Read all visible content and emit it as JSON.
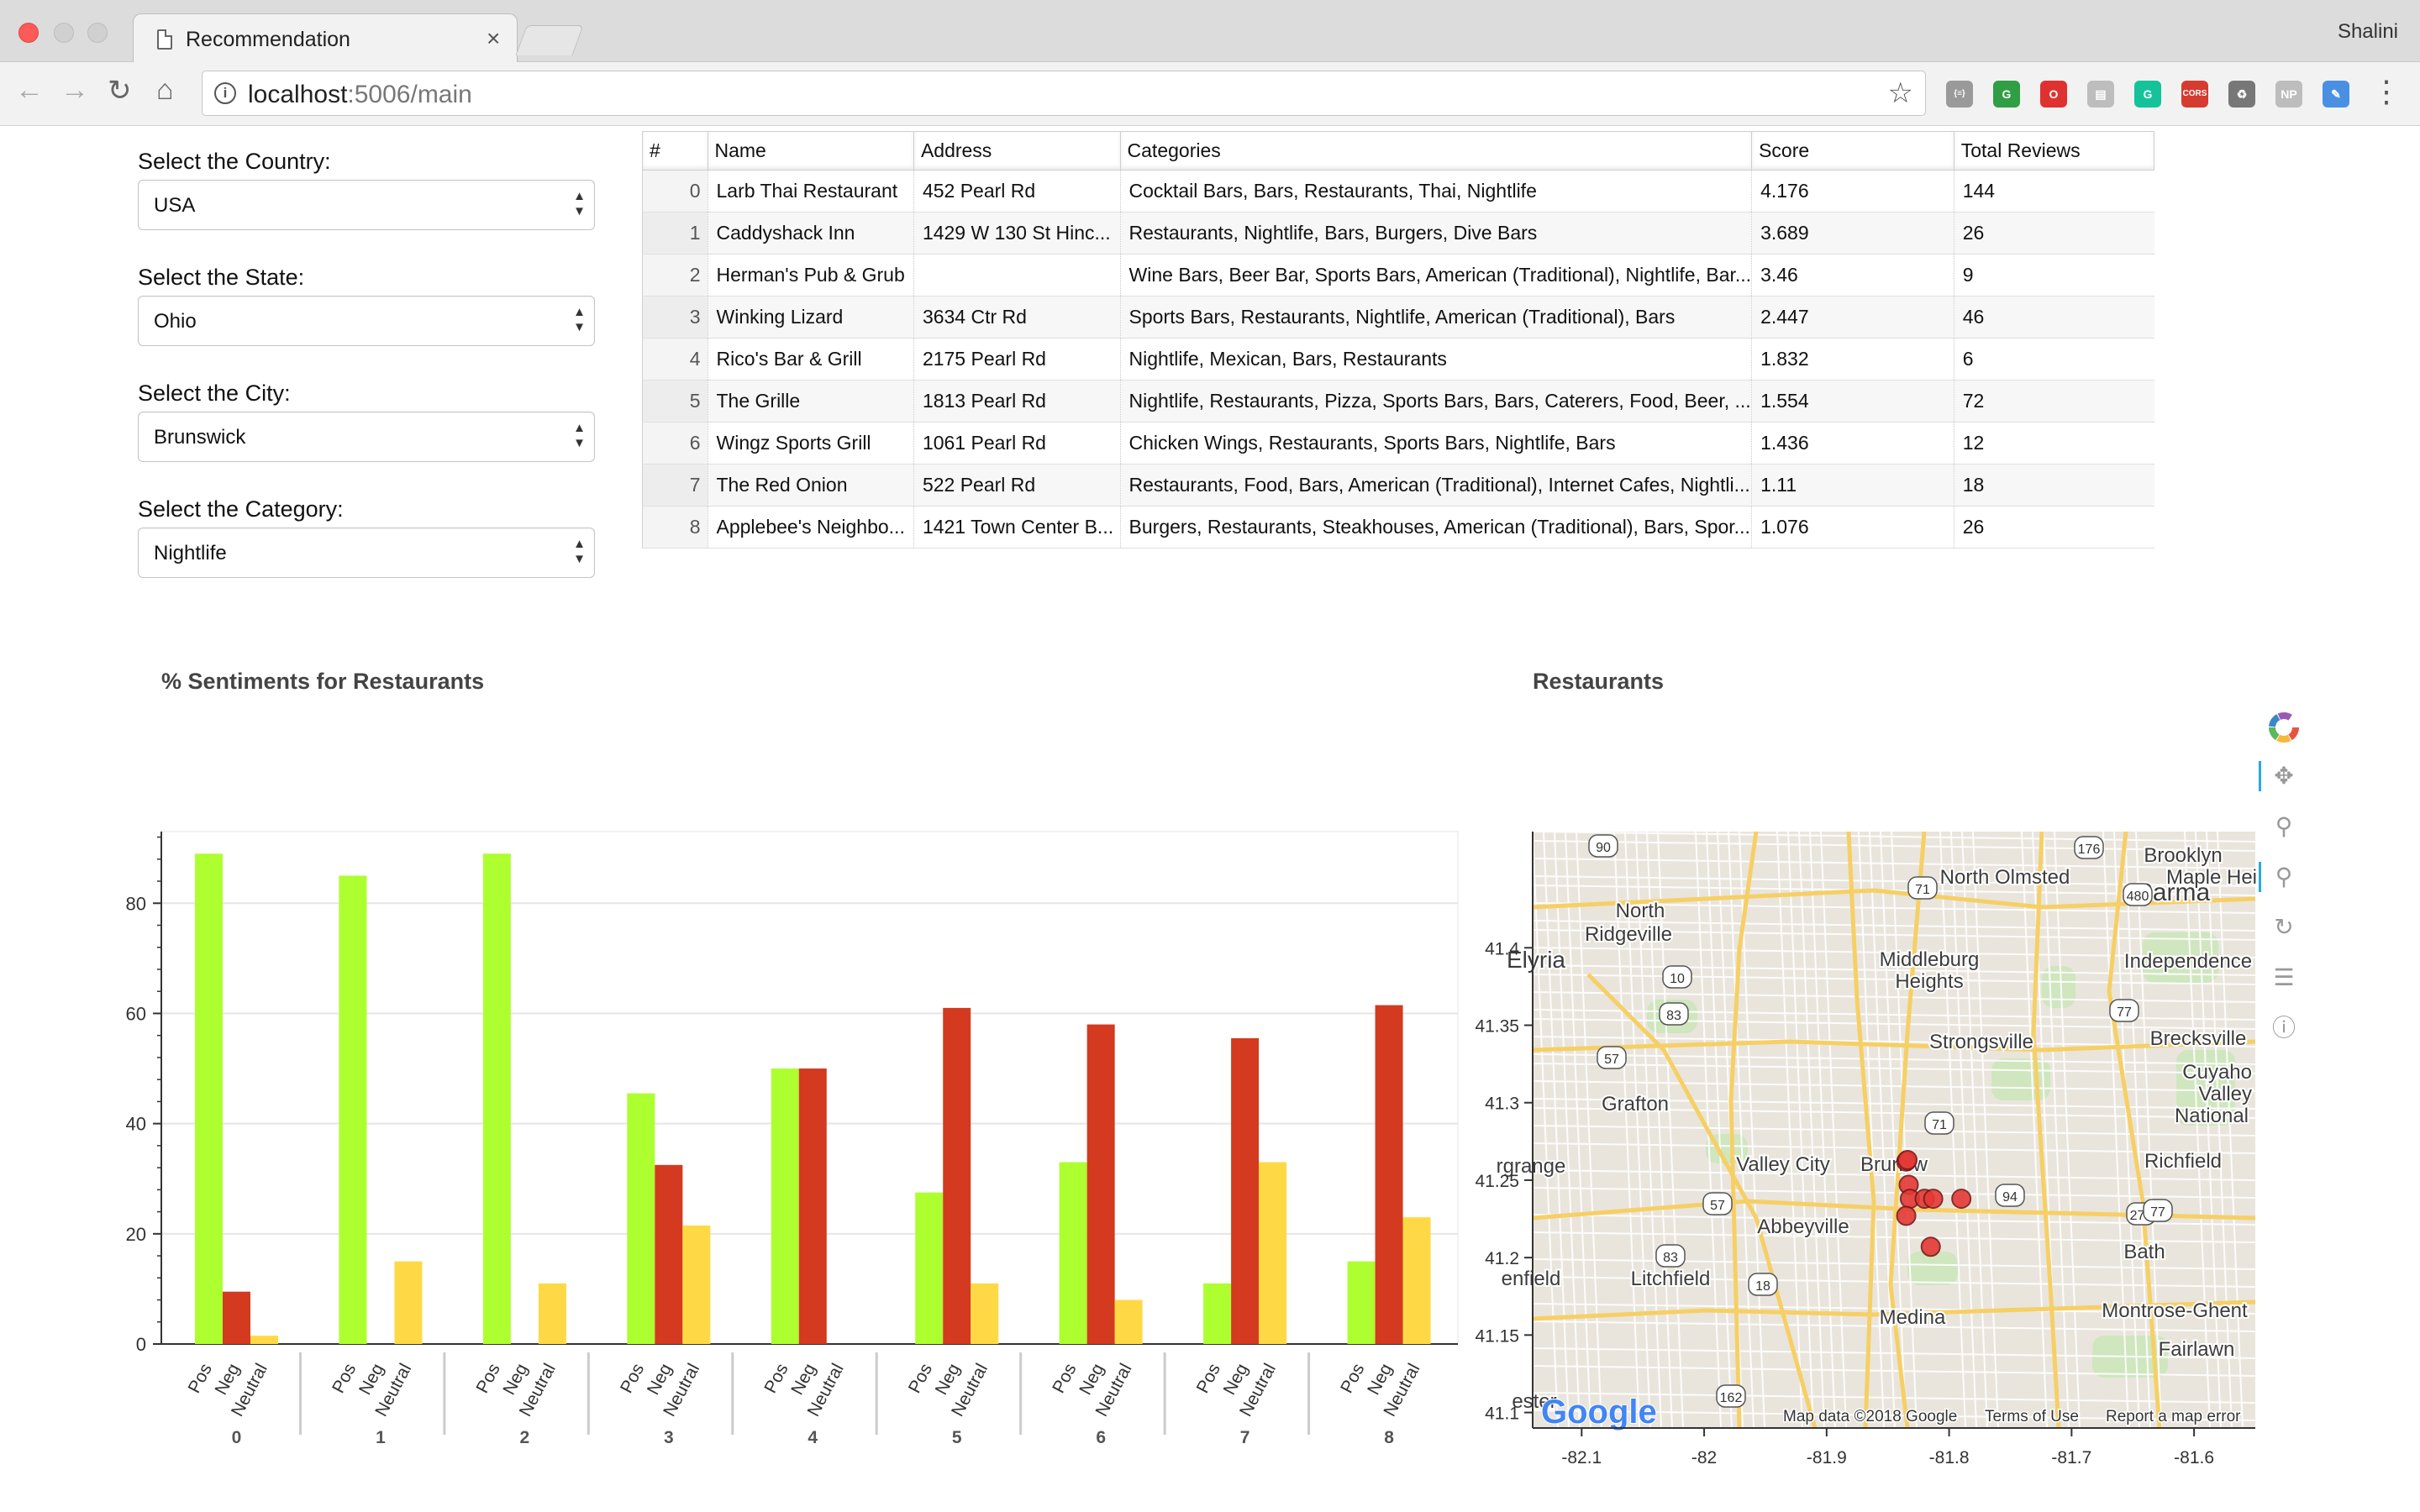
{
  "browser": {
    "tab_title": "Recommendation",
    "tab_close": "×",
    "profile_name": "Shalini",
    "url_host": "localhost",
    "url_rest": ":5006/main",
    "extensions": [
      {
        "name": "json-viewer-icon",
        "label": "{≡}",
        "color": "#9a9a9a"
      },
      {
        "name": "ghostery-icon",
        "label": "G",
        "color": "#2f9e44"
      },
      {
        "name": "opera-icon",
        "label": "O",
        "color": "#e03131"
      },
      {
        "name": "reader-icon",
        "label": "▤",
        "color": "#bdbdbd"
      },
      {
        "name": "grammarly-icon",
        "label": "G",
        "color": "#15c39a"
      },
      {
        "name": "cors-icon",
        "label": "CORS",
        "color": "#d63b2f"
      },
      {
        "name": "recycle-icon",
        "label": "♻",
        "color": "#777777"
      },
      {
        "name": "np-icon",
        "label": "NP",
        "color": "#bdbdbd"
      },
      {
        "name": "pen-icon",
        "label": "✎",
        "color": "#4a90e2"
      }
    ]
  },
  "filters": [
    {
      "label": "Select the Country:",
      "value": "USA"
    },
    {
      "label": "Select the State:",
      "value": "Ohio"
    },
    {
      "label": "Select the City:",
      "value": "Brunswick"
    },
    {
      "label": "Select the Category:",
      "value": "Nightlife"
    }
  ],
  "table": {
    "columns": [
      "#",
      "Name",
      "Address",
      "Categories",
      "Score",
      "Total Reviews"
    ],
    "rows": [
      [
        "0",
        "Larb Thai Restaurant",
        "452 Pearl Rd",
        "Cocktail Bars, Bars, Restaurants, Thai, Nightlife",
        "4.176",
        "144"
      ],
      [
        "1",
        "Caddyshack Inn",
        "1429 W 130 St Hinc...",
        "Restaurants, Nightlife, Bars, Burgers, Dive Bars",
        "3.689",
        "26"
      ],
      [
        "2",
        "Herman's Pub & Grub",
        "",
        "Wine Bars, Beer Bar, Sports Bars, American (Traditional), Nightlife, Bar...",
        "3.46",
        "9"
      ],
      [
        "3",
        "Winking Lizard",
        "3634 Ctr Rd",
        "Sports Bars, Restaurants, Nightlife, American (Traditional), Bars",
        "2.447",
        "46"
      ],
      [
        "4",
        "Rico's Bar & Grill",
        "2175 Pearl Rd",
        "Nightlife, Mexican, Bars, Restaurants",
        "1.832",
        "6"
      ],
      [
        "5",
        "The Grille",
        "1813 Pearl Rd",
        "Nightlife, Restaurants, Pizza, Sports Bars, Bars, Caterers, Food, Beer, ...",
        "1.554",
        "72"
      ],
      [
        "6",
        "Wingz Sports Grill",
        "1061 Pearl Rd",
        "Chicken Wings, Restaurants, Sports Bars, Nightlife, Bars",
        "1.436",
        "12"
      ],
      [
        "7",
        "The Red Onion",
        "522 Pearl Rd",
        "Restaurants, Food, Bars, American (Traditional), Internet Cafes, Nightli...",
        "1.11",
        "18"
      ],
      [
        "8",
        "Applebee's Neighbo...",
        "1421 Town Center B...",
        "Burgers, Restaurants, Steakhouses, American (Traditional), Bars, Spor...",
        "1.076",
        "26"
      ]
    ]
  },
  "chart_data": [
    {
      "type": "bar",
      "title": "% Sentiments for Restaurants",
      "categories": [
        "0",
        "1",
        "2",
        "3",
        "4",
        "5",
        "6",
        "7",
        "8"
      ],
      "subcategories": [
        "Pos",
        "Neg",
        "Neutral"
      ],
      "series": [
        {
          "name": "Pos",
          "color": "#adff2f",
          "values": [
            89,
            85,
            89,
            45.5,
            50,
            27.5,
            33,
            11,
            15
          ]
        },
        {
          "name": "Neg",
          "color": "#d33a1f",
          "values": [
            9.5,
            0,
            0,
            32.5,
            50,
            61,
            58,
            55.5,
            61.5
          ]
        },
        {
          "name": "Neutral",
          "color": "#ffd945",
          "values": [
            1.5,
            15,
            11,
            21.5,
            0,
            11,
            8,
            33,
            23
          ]
        }
      ],
      "yticks": [
        "0",
        "20",
        "40",
        "60",
        "80"
      ],
      "ylim": [
        0,
        93
      ],
      "grid": true
    },
    {
      "type": "scatter",
      "title": "Restaurants",
      "x": [
        -81.835,
        -81.833,
        -81.832,
        -81.835,
        -81.82,
        -81.813,
        -81.79,
        -81.815,
        -81.834
      ],
      "y": [
        41.262,
        41.247,
        41.238,
        41.227,
        41.238,
        41.238,
        41.238,
        41.207,
        41.263
      ],
      "xticks": [
        "-82.1",
        "-82",
        "-81.9",
        "-81.8",
        "-81.7",
        "-81.6"
      ],
      "yticks": [
        "41.1",
        "41.15",
        "41.2",
        "41.25",
        "41.3",
        "41.35",
        "41.4"
      ],
      "xlim": [
        -82.14,
        -81.55
      ],
      "ylim": [
        41.09,
        41.475
      ],
      "marker_color": "#e53935"
    }
  ],
  "map": {
    "labels": [
      {
        "text": "Brooklyn"
      },
      {
        "text": "North Olmsted"
      },
      {
        "text": "Parma"
      },
      {
        "text": "Maple Hei"
      },
      {
        "text": "North"
      },
      {
        "text": "Ridgeville"
      },
      {
        "text": "Elyria"
      },
      {
        "text": "Middleburg"
      },
      {
        "text": "Heights"
      },
      {
        "text": "Independence"
      },
      {
        "text": "Strongsville"
      },
      {
        "text": "Brecksville"
      },
      {
        "text": "Cuyaho"
      },
      {
        "text": "Valley"
      },
      {
        "text": "National"
      },
      {
        "text": "Grafton"
      },
      {
        "text": "Valley City"
      },
      {
        "text": "Brunsw"
      },
      {
        "text": "Richfield"
      },
      {
        "text": "rgrange"
      },
      {
        "text": "Abbeyville"
      },
      {
        "text": "Bath"
      },
      {
        "text": "enfield"
      },
      {
        "text": "Litchfield"
      },
      {
        "text": "Medina"
      },
      {
        "text": "Montrose-Ghent"
      },
      {
        "text": "Fairlawn"
      },
      {
        "text": "ester"
      }
    ],
    "shields": [
      "90",
      "176",
      "71",
      "480",
      "10",
      "83",
      "77",
      "57",
      "71",
      "94",
      "57",
      "271",
      "77",
      "83",
      "18",
      "162"
    ],
    "google_logo": "Google",
    "attribution": "Map data ©2018 Google",
    "terms": "Terms of Use",
    "report": "Report a map error"
  }
}
